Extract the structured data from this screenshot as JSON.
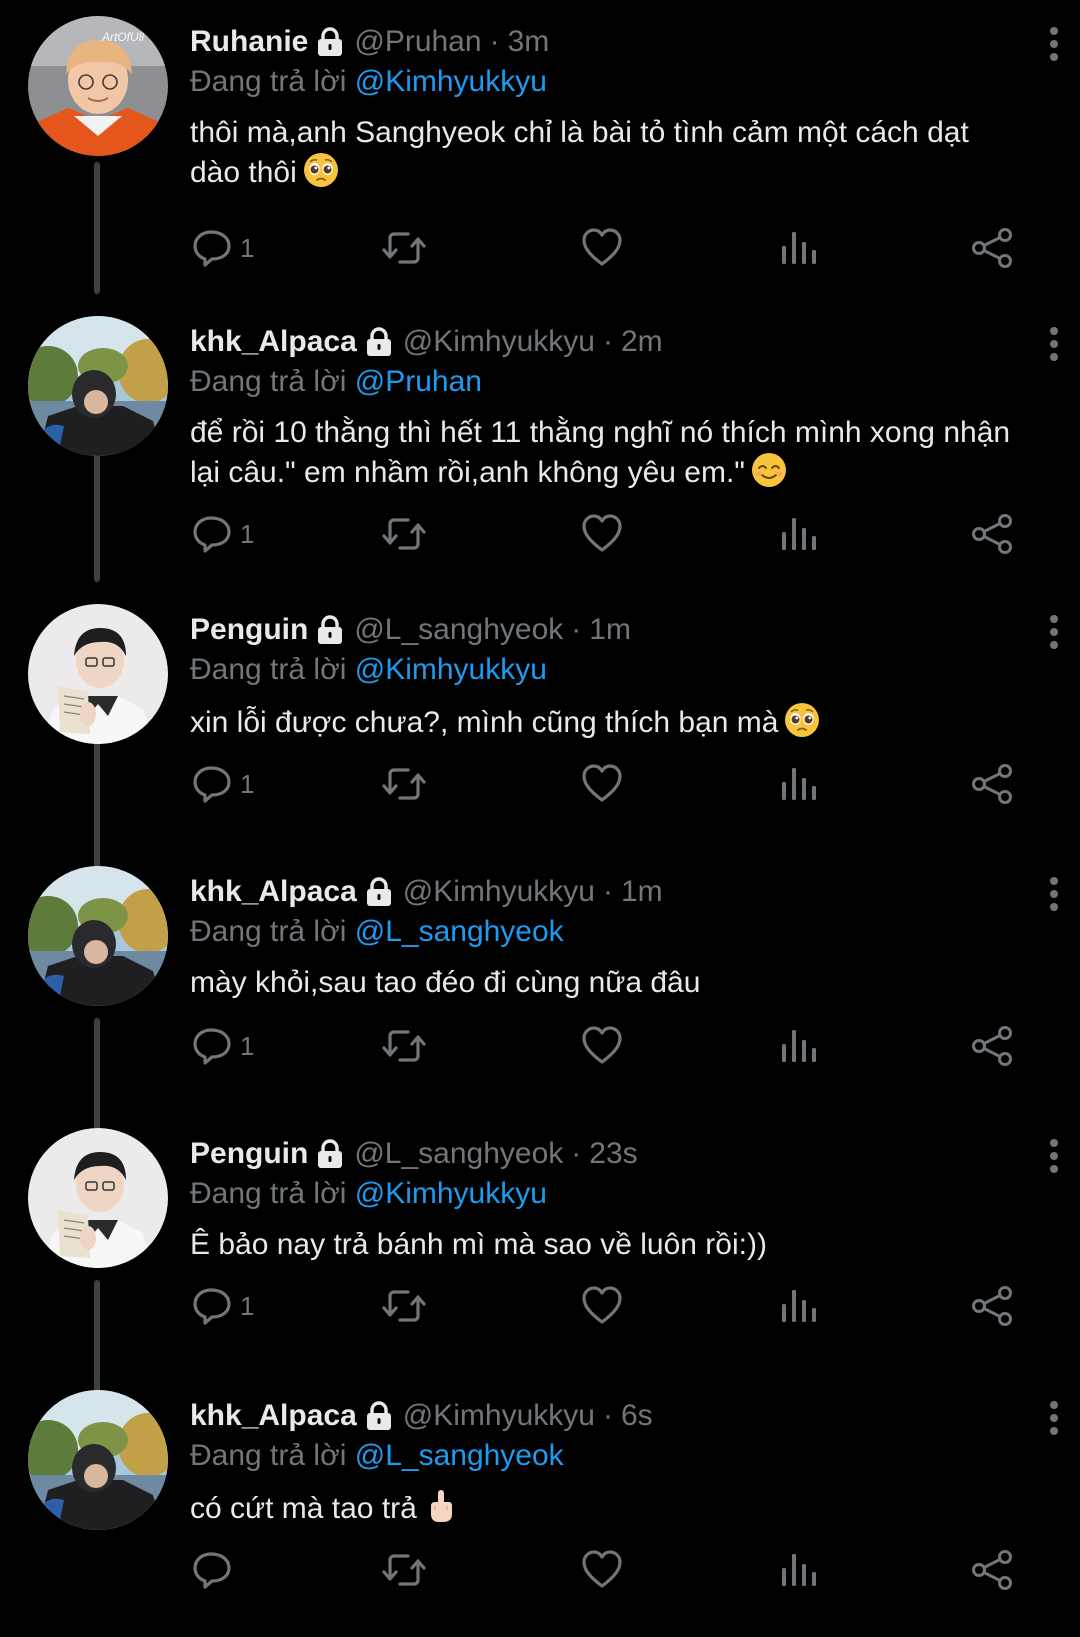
{
  "reply_prefix": "Đang trả lời",
  "colors": {
    "background": "#000000",
    "text_primary": "#e7e9ea",
    "text_secondary": "#71767b",
    "mention": "#1d9bf0",
    "thread_line": "#3e4144"
  },
  "tweets": [
    {
      "display_name": "Ruhanie",
      "handle": "@Pruhan",
      "time": "3m",
      "reply_to": "@Kimhyukkyu",
      "text": "thôi mà,anh Sanghyeok chỉ là bài tỏ tình cảm một cách dạt dào thôi",
      "emoji": "pleading-face-emoji",
      "reply_count": "1",
      "avatar_watermark": "ArtOfUll"
    },
    {
      "display_name": "khk_Alpaca",
      "handle": "@Kimhyukkyu",
      "time": "2m",
      "reply_to": "@Pruhan",
      "text": "để rồi 10 thằng thì hết 11 thằng nghĩ nó thích mình xong nhận lại câu.\" em nhầm rồi,anh không yêu em.\"",
      "emoji": "smiling-face-emoji",
      "reply_count": "1"
    },
    {
      "display_name": "Penguin",
      "handle": "@L_sanghyeok",
      "time": "1m",
      "reply_to": "@Kimhyukkyu",
      "text": "xin lỗi được chưa?, mình cũng thích bạn mà",
      "emoji": "pleading-face-emoji",
      "reply_count": "1"
    },
    {
      "display_name": "khk_Alpaca",
      "handle": "@Kimhyukkyu",
      "time": "1m",
      "reply_to": "@L_sanghyeok",
      "text": "mày khỏi,sau tao đéo đi cùng nữa đâu",
      "emoji": "",
      "reply_count": "1"
    },
    {
      "display_name": "Penguin",
      "handle": "@L_sanghyeok",
      "time": "23s",
      "reply_to": "@Kimhyukkyu",
      "text": "Ê bảo nay trả bánh mì mà sao về luôn rồi:))",
      "emoji": "",
      "reply_count": "1"
    },
    {
      "display_name": "khk_Alpaca",
      "handle": "@Kimhyukkyu",
      "time": "6s",
      "reply_to": "@L_sanghyeok",
      "text": "có cứt mà tao trả",
      "emoji": "middle-finger-emoji",
      "reply_count": ""
    }
  ]
}
